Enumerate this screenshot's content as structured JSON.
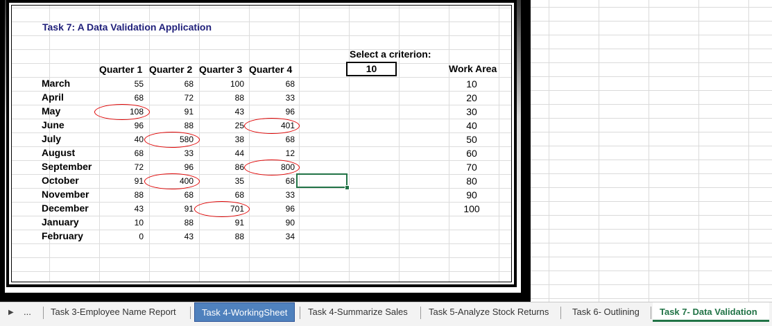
{
  "sheet": {
    "title": "Task 7: A Data Validation Application",
    "headers": [
      "Quarter 1",
      "Quarter 2",
      "Quarter 3",
      "Quarter 4"
    ],
    "rows": [
      {
        "month": "March",
        "q": [
          "55",
          "68",
          "100",
          "68"
        ]
      },
      {
        "month": "April",
        "q": [
          "68",
          "72",
          "88",
          "33"
        ]
      },
      {
        "month": "May",
        "q": [
          "108",
          "91",
          "43",
          "96"
        ]
      },
      {
        "month": "June",
        "q": [
          "96",
          "88",
          "25",
          "401"
        ]
      },
      {
        "month": "July",
        "q": [
          "40",
          "580",
          "38",
          "68"
        ]
      },
      {
        "month": "August",
        "q": [
          "68",
          "33",
          "44",
          "12"
        ]
      },
      {
        "month": "September",
        "q": [
          "72",
          "96",
          "86",
          "800"
        ]
      },
      {
        "month": "October",
        "q": [
          "91",
          "400",
          "35",
          "68"
        ]
      },
      {
        "month": "November",
        "q": [
          "88",
          "68",
          "68",
          "33"
        ]
      },
      {
        "month": "December",
        "q": [
          "43",
          "91",
          "701",
          "96"
        ]
      },
      {
        "month": "January",
        "q": [
          "10",
          "88",
          "91",
          "90"
        ]
      },
      {
        "month": "February",
        "q": [
          "0",
          "43",
          "88",
          "34"
        ]
      }
    ],
    "criterion_label": "Select a criterion:",
    "criterion_value": "10",
    "work_area_title": "Work Area",
    "work_area": [
      "10",
      "20",
      "30",
      "40",
      "50",
      "60",
      "70",
      "80",
      "90",
      "100"
    ],
    "invalid_marker_color": "#e00000"
  },
  "tabs": {
    "ellipsis": "...",
    "items": [
      {
        "label": "Task 3-Employee Name Report"
      },
      {
        "label": "Task 4-WorkingSheet"
      },
      {
        "label": "Task 4-Summarize Sales"
      },
      {
        "label": "Task 5-Analyze Stock Returns"
      },
      {
        "label": "Task 6- Outlining"
      },
      {
        "label": "Task 7- Data Validation"
      }
    ],
    "active_color": "#217346",
    "highlight_color": "#4f81bd"
  }
}
